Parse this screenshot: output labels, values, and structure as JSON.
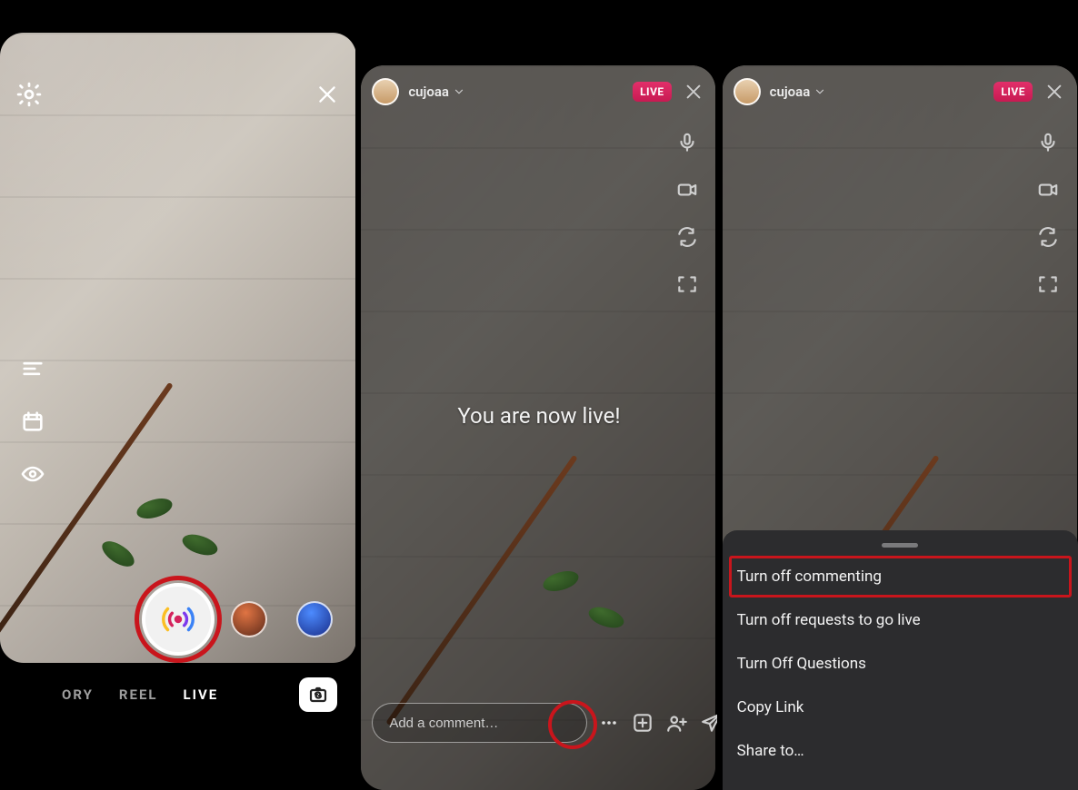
{
  "colors": {
    "highlight": "#c9151c",
    "live_badge": "#d4235d"
  },
  "panel1": {
    "modes": {
      "story": "ORY",
      "reel": "REEL",
      "live": "LIVE"
    },
    "active_mode": "LIVE"
  },
  "panel2": {
    "username": "cujoaa",
    "live_badge": "LIVE",
    "now_live_text": "You are now live!",
    "comment_placeholder": "Add a comment…"
  },
  "panel3": {
    "username": "cujoaa",
    "live_badge": "LIVE",
    "sheet": {
      "items": [
        "Turn off commenting",
        "Turn off requests to go live",
        "Turn Off Questions",
        "Copy Link",
        "Share to…"
      ],
      "highlighted_index": 0
    }
  }
}
